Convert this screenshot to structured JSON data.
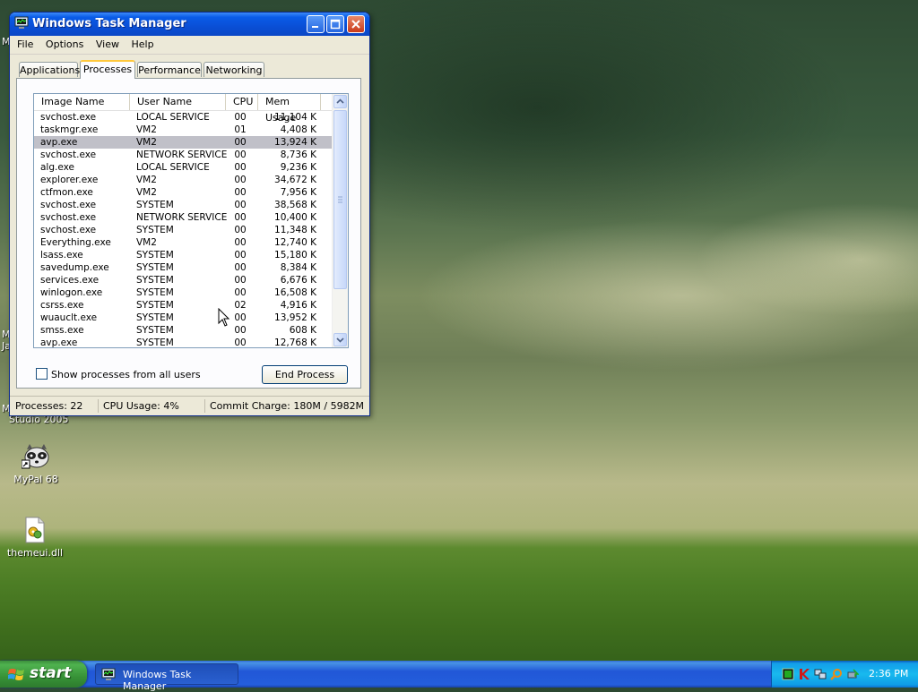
{
  "window": {
    "title": "Windows Task Manager",
    "menu": [
      "File",
      "Options",
      "View",
      "Help"
    ],
    "tabs": [
      "Applications",
      "Processes",
      "Performance",
      "Networking"
    ],
    "active_tab": "Processes",
    "columns": [
      "Image Name",
      "User Name",
      "CPU",
      "Mem Usage"
    ],
    "rows": [
      [
        "svchost.exe",
        "LOCAL SERVICE",
        "00",
        "11,104 K"
      ],
      [
        "taskmgr.exe",
        "VM2",
        "01",
        "4,408 K"
      ],
      [
        "avp.exe",
        "VM2",
        "00",
        "13,924 K"
      ],
      [
        "svchost.exe",
        "NETWORK SERVICE",
        "00",
        "8,736 K"
      ],
      [
        "alg.exe",
        "LOCAL SERVICE",
        "00",
        "9,236 K"
      ],
      [
        "explorer.exe",
        "VM2",
        "00",
        "34,672 K"
      ],
      [
        "ctfmon.exe",
        "VM2",
        "00",
        "7,956 K"
      ],
      [
        "svchost.exe",
        "SYSTEM",
        "00",
        "38,568 K"
      ],
      [
        "svchost.exe",
        "NETWORK SERVICE",
        "00",
        "10,400 K"
      ],
      [
        "svchost.exe",
        "SYSTEM",
        "00",
        "11,348 K"
      ],
      [
        "Everything.exe",
        "VM2",
        "00",
        "12,740 K"
      ],
      [
        "lsass.exe",
        "SYSTEM",
        "00",
        "15,180 K"
      ],
      [
        "savedump.exe",
        "SYSTEM",
        "00",
        "8,384 K"
      ],
      [
        "services.exe",
        "SYSTEM",
        "00",
        "6,676 K"
      ],
      [
        "winlogon.exe",
        "SYSTEM",
        "00",
        "16,508 K"
      ],
      [
        "csrss.exe",
        "SYSTEM",
        "02",
        "4,916 K"
      ],
      [
        "wuauclt.exe",
        "SYSTEM",
        "00",
        "13,952 K"
      ],
      [
        "smss.exe",
        "SYSTEM",
        "00",
        "608 K"
      ],
      [
        "avp.exe",
        "SYSTEM",
        "00",
        "12,768 K"
      ]
    ],
    "selected_row_index": 2,
    "show_all_users_label": "Show processes from all users",
    "end_process_label": "End Process",
    "status": {
      "processes": "Processes: 22",
      "cpu": "CPU Usage: 4%",
      "commit": "Commit Charge: 180M / 5982M"
    }
  },
  "desktop": {
    "edge_labels": [
      "M",
      "M",
      "Ja",
      "M",
      "Studio 2005"
    ],
    "icons": [
      {
        "label": "MyPal 68",
        "icon": "raccoon-icon"
      },
      {
        "label": "themeui.dll",
        "icon": "dll-file-icon"
      }
    ]
  },
  "taskbar": {
    "start_label": "start",
    "task_button_label": "Windows Task Manager",
    "clock": "2:36 PM",
    "tray_icons": [
      "task-manager-tray-icon",
      "antivirus-icon",
      "network-icon",
      "search-tool-icon",
      "safely-remove-icon"
    ]
  }
}
